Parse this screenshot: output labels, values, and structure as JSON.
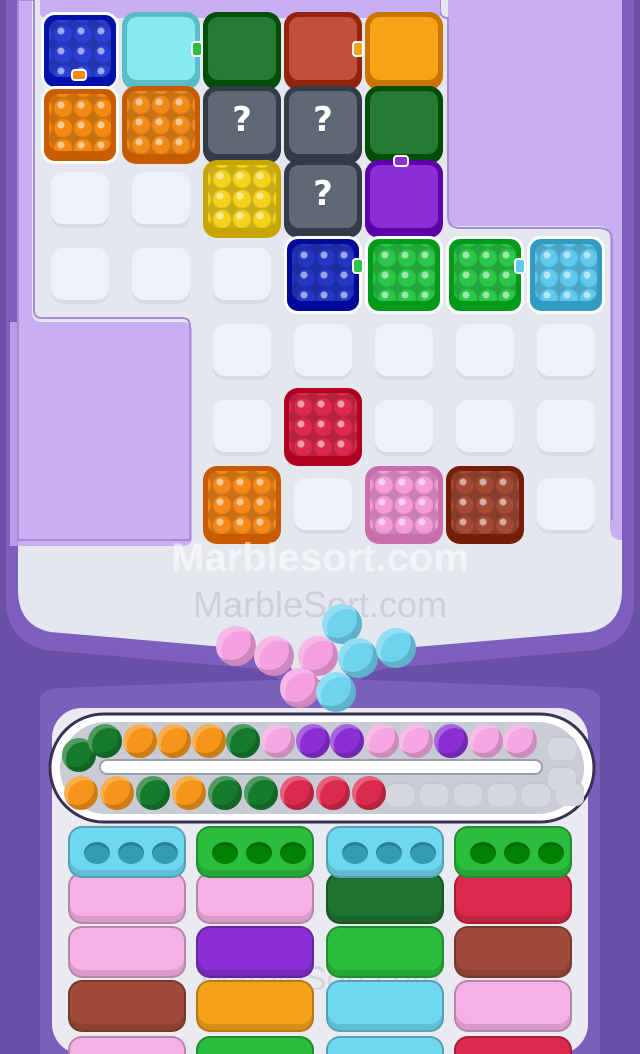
{
  "watermarks": [
    "Marblesort.com",
    "MarbleSort.com",
    "MarbleSort.com"
  ],
  "question_mark": "?",
  "colors": {
    "background": "#6a4fa8",
    "board": "#e4e7ee",
    "panel": "#c9b1f0",
    "tray": "#ffffff"
  },
  "board": {
    "tiles": [
      {
        "row": 0,
        "col": 0,
        "color": "#2c3fd6",
        "state": "selected"
      },
      {
        "row": 0,
        "col": 1,
        "color": "#86eaf2",
        "state": "plain"
      },
      {
        "row": 0,
        "col": 2,
        "color": "#257a34",
        "state": "plain"
      },
      {
        "row": 0,
        "col": 3,
        "color": "#c0503a",
        "state": "plain"
      },
      {
        "row": 0,
        "col": 4,
        "color": "#f6a316",
        "state": "plain"
      },
      {
        "row": 1,
        "col": 0,
        "color": "#f58a13",
        "state": "selected"
      },
      {
        "row": 1,
        "col": 1,
        "color": "#f28a18",
        "state": "ready"
      },
      {
        "row": 1,
        "col": 2,
        "color": "#5f6873",
        "state": "hidden"
      },
      {
        "row": 1,
        "col": 3,
        "color": "#5f6873",
        "state": "hidden"
      },
      {
        "row": 1,
        "col": 4,
        "color": "#257a34",
        "state": "plain"
      },
      {
        "row": 2,
        "col": 2,
        "color": "#f5d31d",
        "state": "ready"
      },
      {
        "row": 2,
        "col": 3,
        "color": "#5f6873",
        "state": "hidden"
      },
      {
        "row": 2,
        "col": 4,
        "color": "#8a2fd4",
        "state": "plain"
      },
      {
        "row": 3,
        "col": 3,
        "color": "#2436c4",
        "state": "selected"
      },
      {
        "row": 3,
        "col": 4,
        "color": "#2bc748",
        "state": "selected"
      },
      {
        "row": 3,
        "col": 5,
        "color": "#2bc748",
        "state": "selected"
      },
      {
        "row": 3,
        "col": 6,
        "color": "#5ec8ee",
        "state": "selected"
      },
      {
        "row": 5,
        "col": 3,
        "color": "#dc2a4c",
        "state": "ready"
      },
      {
        "row": 6,
        "col": 2,
        "color": "#f5881a",
        "state": "ready"
      },
      {
        "row": 6,
        "col": 4,
        "color": "#f49bd8",
        "state": "ready"
      },
      {
        "row": 6,
        "col": 5,
        "color": "#a34a35",
        "state": "ready"
      }
    ]
  },
  "falling_marbles": [
    "#f4a0e0",
    "#f4a0e0",
    "#f4a0e0",
    "#f4a0e0",
    "#6fd3ef",
    "#6fd3ef",
    "#6fd3ef",
    "#6fd3ef"
  ],
  "conveyor": {
    "top_row": [
      "#157a2c",
      "#157a2c",
      "#f5951a",
      "#f5951a",
      "#f5951a",
      "#157a2c",
      "#f4a7e2",
      "#8a2fd4",
      "#8a2fd4",
      "#f4a7e2",
      "#f4a7e2",
      "#8a2fd4",
      "#f4a7e2",
      "#f4a7e2"
    ],
    "bottom_row": [
      "#f5951a",
      "#f5951a",
      "#157a2c",
      "#f5951a",
      "#157a2c",
      "#157a2c",
      "#dc2a4c",
      "#dc2a4c",
      "#dc2a4c"
    ],
    "empty_slots": 8
  },
  "boxes": [
    {
      "col": 0,
      "colors": [
        "#6fd8f0",
        "#f6b0e4",
        "#f6b0e4",
        "#a04a3a",
        "#f6b0e4"
      ]
    },
    {
      "col": 1,
      "colors": [
        "#2bbd3e",
        "#f6b0e4",
        "#8a2fd4",
        "#f5a21b",
        "#2bbd3e"
      ]
    },
    {
      "col": 2,
      "colors": [
        "#6fd8f0",
        "#1f7330",
        "#2bbd3e",
        "#6fd8f0",
        "#6fd8f0"
      ]
    },
    {
      "col": 3,
      "colors": [
        "#2bbd3e",
        "#dc2a4c",
        "#a04a3a",
        "#f6b0e4",
        "#dc2a4c"
      ]
    }
  ]
}
